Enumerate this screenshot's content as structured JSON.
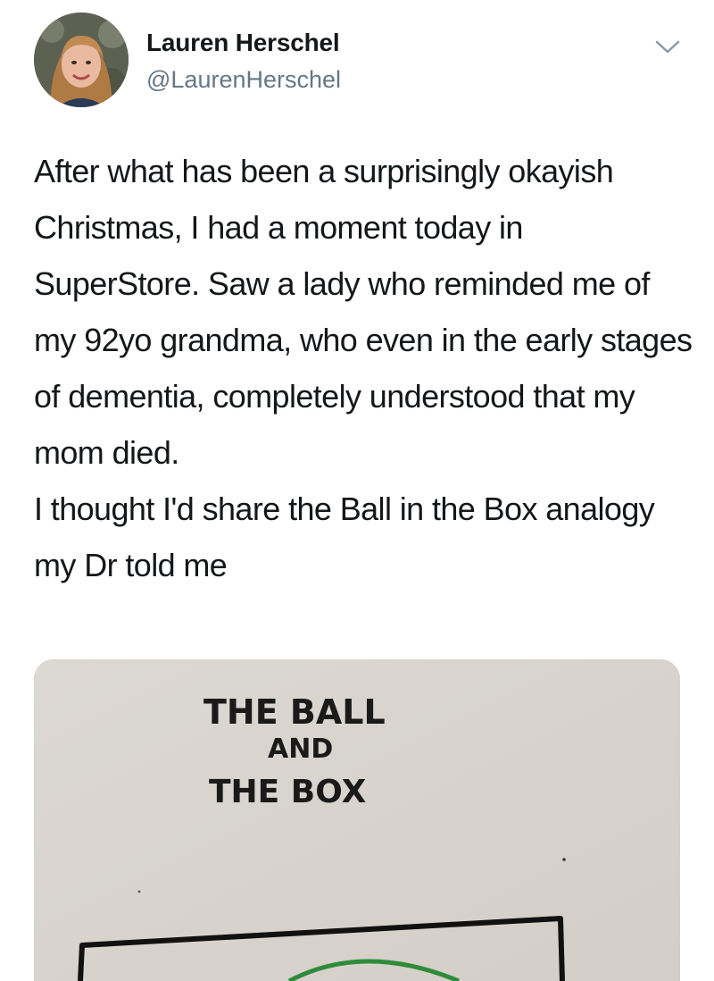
{
  "user": {
    "display_name": "Lauren Herschel",
    "handle": "@LaurenHerschel",
    "avatar_icon": "profile-photo",
    "menu_icon": "chevron-down-icon"
  },
  "tweet": {
    "paragraph_1": "After what has been a surprisingly okayish Christmas, I had a moment today in SuperStore. Saw a lady who reminded me of my 92yo grandma, who even in the early stages of dementia, completely understood that my mom died.",
    "paragraph_2": "I thought I'd share the Ball in the Box analogy my Dr told me"
  },
  "media": {
    "title_line_1": "THE BALL",
    "title_line_2": "AND",
    "title_line_3": "THE BOX",
    "ball_color": "#2e8b3a"
  },
  "colors": {
    "text": "#14171a",
    "secondary": "#657786",
    "paper": "#d9d5cf"
  }
}
